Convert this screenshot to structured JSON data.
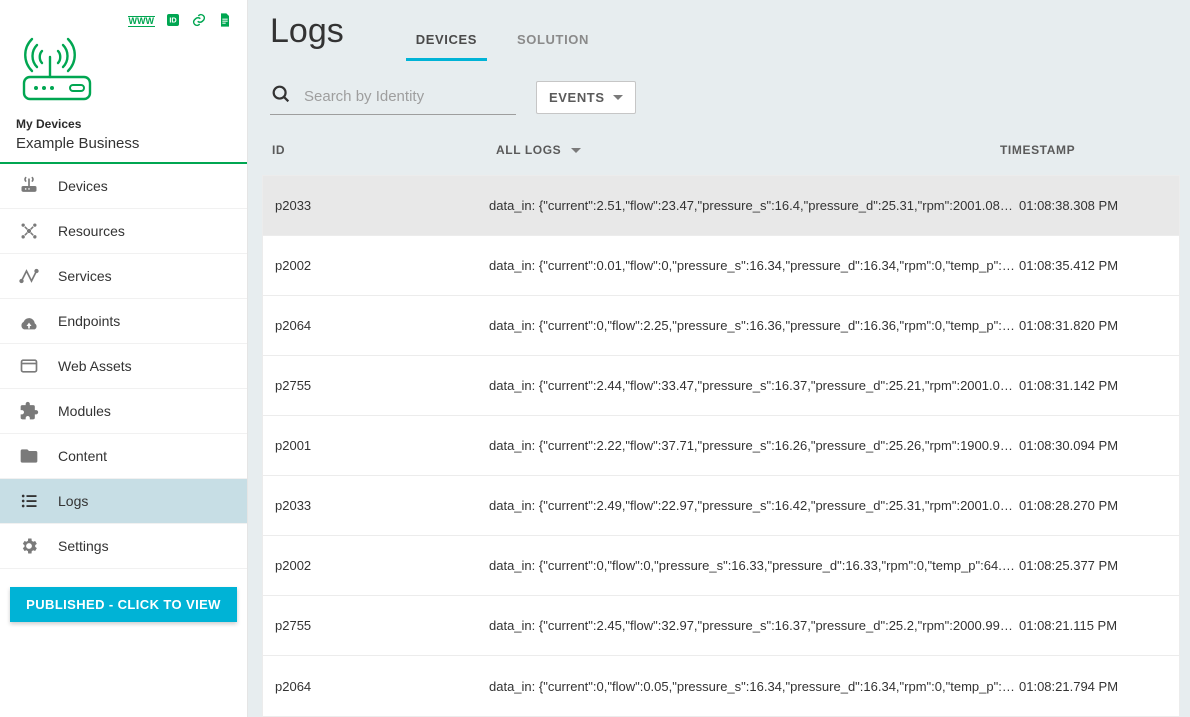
{
  "sidebar": {
    "section_label": "My Devices",
    "business_name": "Example Business",
    "items": [
      {
        "key": "devices",
        "label": "Devices"
      },
      {
        "key": "resources",
        "label": "Resources"
      },
      {
        "key": "services",
        "label": "Services"
      },
      {
        "key": "endpoints",
        "label": "Endpoints"
      },
      {
        "key": "webassets",
        "label": "Web Assets"
      },
      {
        "key": "modules",
        "label": "Modules"
      },
      {
        "key": "content",
        "label": "Content"
      },
      {
        "key": "logs",
        "label": "Logs"
      },
      {
        "key": "settings",
        "label": "Settings"
      }
    ],
    "active_item": "logs",
    "published_button": "PUBLISHED - CLICK TO VIEW"
  },
  "header": {
    "page_title": "Logs",
    "tabs": {
      "devices": "DEVICES",
      "solution": "SOLUTION"
    },
    "active_tab": "devices"
  },
  "controls": {
    "search_placeholder": "Search by Identity",
    "events_button": "EVENTS"
  },
  "table": {
    "headers": {
      "id": "ID",
      "logs": "ALL LOGS",
      "timestamp": "TIMESTAMP"
    },
    "rows": [
      {
        "id": "p2033",
        "log": "data_in: {\"current\":2.51,\"flow\":23.47,\"pressure_s\":16.4,\"pressure_d\":25.31,\"rpm\":2001.08…",
        "ts": "01:08:38.308 PM",
        "highlight": true
      },
      {
        "id": "p2002",
        "log": "data_in: {\"current\":0.01,\"flow\":0,\"pressure_s\":16.34,\"pressure_d\":16.34,\"rpm\":0,\"temp_p\":…",
        "ts": "01:08:35.412 PM"
      },
      {
        "id": "p2064",
        "log": "data_in: {\"current\":0,\"flow\":2.25,\"pressure_s\":16.36,\"pressure_d\":16.36,\"rpm\":0,\"temp_p\":…",
        "ts": "01:08:31.820 PM"
      },
      {
        "id": "p2755",
        "log": "data_in: {\"current\":2.44,\"flow\":33.47,\"pressure_s\":16.37,\"pressure_d\":25.21,\"rpm\":2001.0…",
        "ts": "01:08:31.142 PM"
      },
      {
        "id": "p2001",
        "log": "data_in: {\"current\":2.22,\"flow\":37.71,\"pressure_s\":16.26,\"pressure_d\":25.26,\"rpm\":1900.9…",
        "ts": "01:08:30.094 PM"
      },
      {
        "id": "p2033",
        "log": "data_in: {\"current\":2.49,\"flow\":22.97,\"pressure_s\":16.42,\"pressure_d\":25.31,\"rpm\":2001.0…",
        "ts": "01:08:28.270 PM"
      },
      {
        "id": "p2002",
        "log": "data_in: {\"current\":0,\"flow\":0,\"pressure_s\":16.33,\"pressure_d\":16.33,\"rpm\":0,\"temp_p\":64.…",
        "ts": "01:08:25.377 PM"
      },
      {
        "id": "p2755",
        "log": "data_in: {\"current\":2.45,\"flow\":32.97,\"pressure_s\":16.37,\"pressure_d\":25.2,\"rpm\":2000.99…",
        "ts": "01:08:21.115 PM"
      },
      {
        "id": "p2064",
        "log": "data_in: {\"current\":0,\"flow\":0.05,\"pressure_s\":16.34,\"pressure_d\":16.34,\"rpm\":0,\"temp_p\":…",
        "ts": "01:08:21.794 PM"
      }
    ]
  },
  "colors": {
    "brand_green": "#00a651",
    "accent_teal": "#00b3d6",
    "page_bg": "#e7edef",
    "nav_active_bg": "#c7dee5"
  }
}
